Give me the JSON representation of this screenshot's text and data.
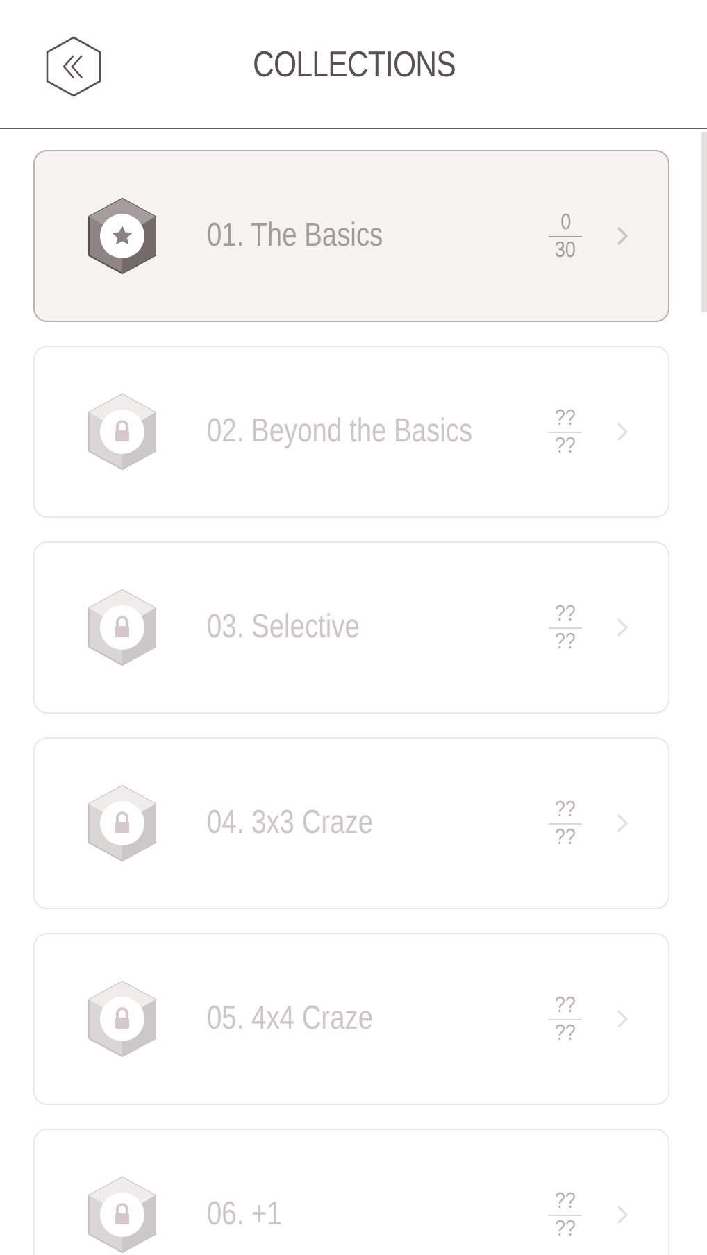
{
  "header": {
    "title": "COLLECTIONS"
  },
  "collections": [
    {
      "name": "01. The Basics",
      "solved": "0",
      "total": "30",
      "locked": false,
      "selected": true
    },
    {
      "name": "02. Beyond the Basics",
      "solved": "??",
      "total": "??",
      "locked": true,
      "selected": false
    },
    {
      "name": "03. Selective",
      "solved": "??",
      "total": "??",
      "locked": true,
      "selected": false
    },
    {
      "name": "04. 3x3 Craze",
      "solved": "??",
      "total": "??",
      "locked": true,
      "selected": false
    },
    {
      "name": "05. 4x4 Craze",
      "solved": "??",
      "total": "??",
      "locked": true,
      "selected": false
    },
    {
      "name": "06. +1",
      "solved": "??",
      "total": "??",
      "locked": true,
      "selected": false
    }
  ]
}
